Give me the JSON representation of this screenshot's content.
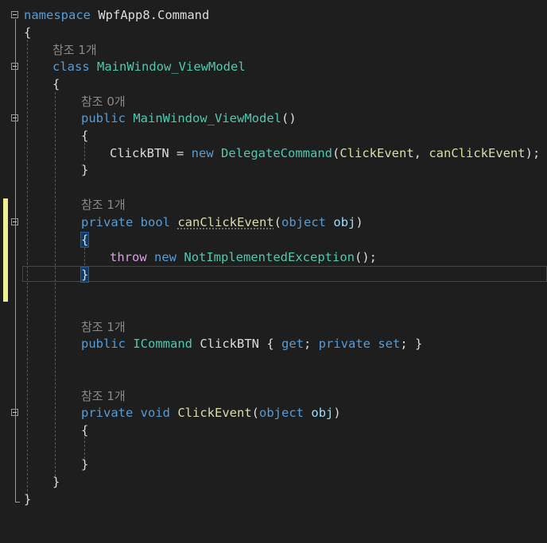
{
  "editor": {
    "lines": {
      "l1": {
        "kw": "namespace",
        "name": "WpfApp8.Command"
      },
      "l2": {
        "brace": "{"
      },
      "l3": {
        "ref": "참조 1개"
      },
      "l4": {
        "kw": "class",
        "name": "MainWindow_ViewModel"
      },
      "l5": {
        "brace": "{"
      },
      "l6": {
        "ref": "참조 0개"
      },
      "l7": {
        "kw": "public",
        "name": "MainWindow_ViewModel",
        "rest": "()"
      },
      "l8": {
        "brace": "{"
      },
      "l9": {
        "a": "ClickBTN = ",
        "kw": "new",
        "type": "DelegateCommand",
        "open": "(",
        "arg1": "ClickEvent",
        "sep": ", ",
        "arg2": "canClickEvent",
        "close": ");"
      },
      "l10": {
        "brace": "}"
      },
      "l11": {
        "ref": "참조 1개"
      },
      "l12": {
        "kw1": "private",
        "kw2": "bool",
        "name": "canClickEvent",
        "open": "(",
        "ptype": "object",
        "pname": "obj",
        "close": ")"
      },
      "l13": {
        "brace": "{"
      },
      "l14": {
        "kw1": "throw",
        "kw2": "new",
        "type": "NotImplementedException",
        "rest": "();"
      },
      "l15": {
        "brace": "}"
      },
      "l16": {
        "ref": "참조 1개"
      },
      "l17": {
        "kw": "public",
        "type": "ICommand",
        "name": "ClickBTN",
        "o": " { ",
        "get": "get",
        "semi": "; ",
        "priv": "private",
        "set": "set",
        "end": "; }"
      },
      "l18": {
        "ref": "참조 1개"
      },
      "l19": {
        "kw1": "private",
        "kw2": "void",
        "name": "ClickEvent",
        "open": "(",
        "ptype": "object",
        "pname": "obj",
        "close": ")"
      },
      "l20": {
        "brace": "{"
      },
      "l21": {
        "brace": "}"
      },
      "l22": {
        "brace": "}"
      },
      "l23": {
        "brace": "}"
      }
    },
    "colors": {
      "background": "#1e1e1e",
      "keyword": "#569cd6",
      "type": "#4ec9b0",
      "method": "#dcdcaa",
      "text": "#dcdcdc",
      "codelens": "#8a8a8a",
      "change_marker": "#efef95"
    }
  }
}
